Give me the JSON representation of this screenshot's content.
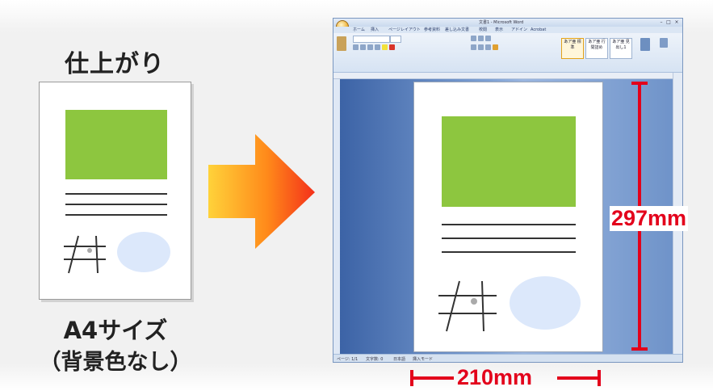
{
  "finished": {
    "title": "仕上がり"
  },
  "caption": {
    "size": "A4サイズ",
    "background": "（背景色なし）"
  },
  "word": {
    "title": "文書1 - Microsoft Word",
    "window_buttons": [
      "–",
      "□",
      "×"
    ],
    "tabs": [
      "ホーム",
      "挿入",
      "ページレイアウト",
      "参考資料",
      "差し込み文書",
      "校閲",
      "表示",
      "アドイン",
      "Acrobat"
    ],
    "styles": [
      "あア亜 標準",
      "あア亜 行間詰め",
      "あア亜 見出し1"
    ],
    "status": [
      "ページ: 1/1",
      "文字数: 0",
      "日本語",
      "挿入モード"
    ]
  },
  "dimensions": {
    "height": "297mm",
    "width": "210mm"
  },
  "colors": {
    "accent_red": "#e3001b",
    "image_green": "#8dc63f",
    "ellipse_blue": "#dce8fb"
  }
}
